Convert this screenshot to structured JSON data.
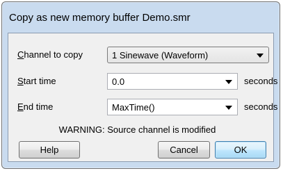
{
  "window": {
    "title": "Copy as new memory buffer Demo.smr"
  },
  "form": {
    "channel": {
      "label_key": "C",
      "label_rest": "hannel to copy",
      "value": "1 Sinewave (Waveform)"
    },
    "start_time": {
      "label_key": "S",
      "label_rest": "tart time",
      "value": "0.0",
      "unit": "seconds"
    },
    "end_time": {
      "label_key": "E",
      "label_rest": "nd time",
      "value": "MaxTime()",
      "unit": "seconds"
    },
    "warning": "WARNING: Source channel is modified"
  },
  "buttons": {
    "help": "Help",
    "cancel": "Cancel",
    "ok": "OK"
  },
  "colors": {
    "frame": "#c9dbef",
    "client": "#f0f0f0",
    "default_button_border": "#3c7fb1"
  }
}
